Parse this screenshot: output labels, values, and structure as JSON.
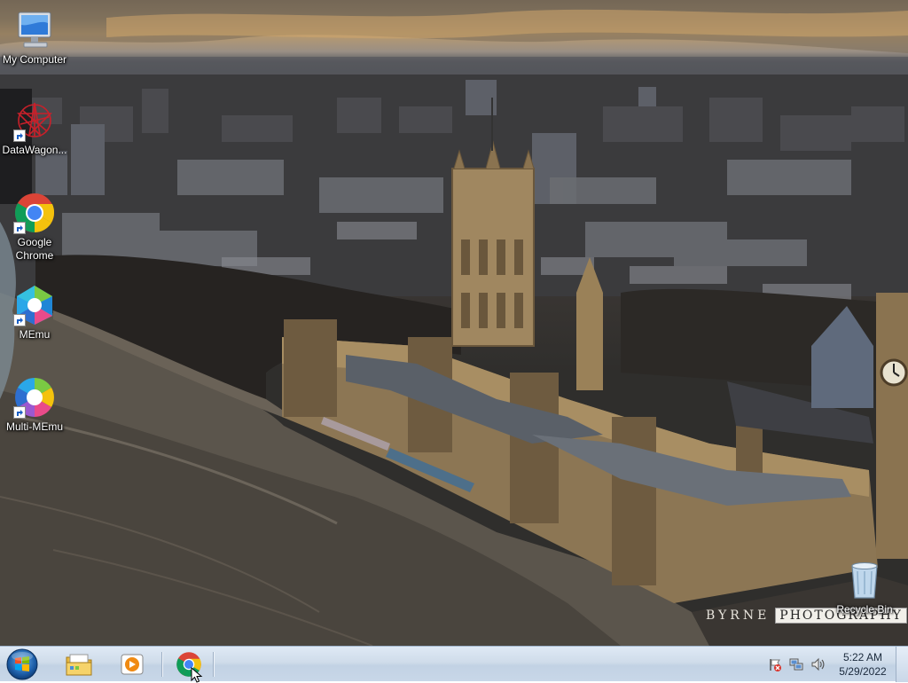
{
  "desktop": {
    "icons": [
      {
        "label": "My Computer",
        "icon": "computer-icon"
      },
      {
        "label": "DataWagon...",
        "icon": "datawagon-icon"
      },
      {
        "label": "Google Chrome",
        "icon": "chrome-icon"
      },
      {
        "label": "MEmu",
        "icon": "memu-icon"
      },
      {
        "label": "Multi-MEmu",
        "icon": "multi-memu-icon"
      },
      {
        "label": "Recycle Bin",
        "icon": "recycle-bin-icon"
      }
    ],
    "wallpaper_watermark": {
      "part1": "BYRNE",
      "part2": "PHOTOGRAPHY"
    }
  },
  "taskbar": {
    "start_button": "start-orb-icon",
    "pinned": [
      {
        "name": "Windows Explorer",
        "icon": "folder-icon"
      },
      {
        "name": "Media Player",
        "icon": "media-player-icon"
      },
      {
        "name": "Google Chrome",
        "icon": "chrome-icon"
      }
    ],
    "tray": {
      "icons": [
        "action-center-flag-icon",
        "network-icon",
        "volume-icon"
      ],
      "time": "5:22 AM",
      "date": "5/29/2022"
    }
  },
  "colors": {
    "taskbar": "#cfdcea",
    "chrome_red": "#db4437",
    "chrome_yellow": "#f4c20d",
    "chrome_green": "#0f9d58",
    "chrome_blue": "#4285f4"
  }
}
